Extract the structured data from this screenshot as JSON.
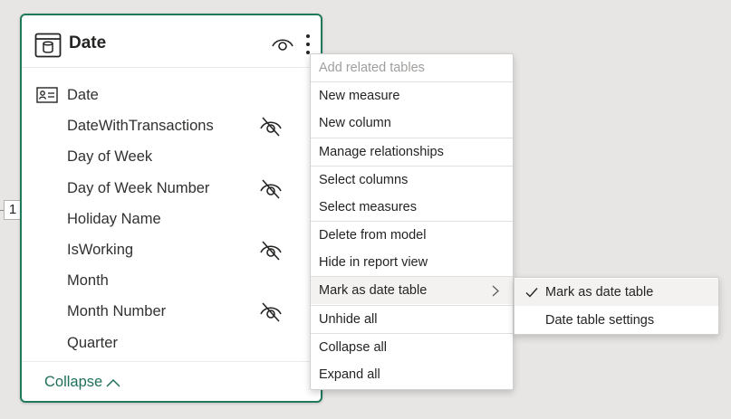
{
  "card": {
    "title": "Date",
    "fields": [
      {
        "label": "Date",
        "hidden": false,
        "key": true
      },
      {
        "label": "DateWithTransactions",
        "hidden": true,
        "key": false
      },
      {
        "label": "Day of Week",
        "hidden": false,
        "key": false
      },
      {
        "label": "Day of Week Number",
        "hidden": true,
        "key": false
      },
      {
        "label": "Holiday Name",
        "hidden": false,
        "key": false
      },
      {
        "label": "IsWorking",
        "hidden": true,
        "key": false
      },
      {
        "label": "Month",
        "hidden": false,
        "key": false
      },
      {
        "label": "Month Number",
        "hidden": true,
        "key": false
      },
      {
        "label": "Quarter",
        "hidden": false,
        "key": false
      }
    ],
    "collapse_label": "Collapse"
  },
  "relationship_marker": "1",
  "context_menu": {
    "items": [
      {
        "label": "Add related tables",
        "disabled": true
      },
      {
        "label": "New measure"
      },
      {
        "label": "New column"
      },
      {
        "label": "Manage relationships"
      },
      {
        "label": "Select columns"
      },
      {
        "label": "Select measures"
      },
      {
        "label": "Delete from model"
      },
      {
        "label": "Hide in report view"
      },
      {
        "label": "Mark as date table",
        "submenu": true,
        "active": true
      },
      {
        "label": "Unhide all"
      },
      {
        "label": "Collapse all"
      },
      {
        "label": "Expand all"
      }
    ]
  },
  "submenu": {
    "items": [
      {
        "label": "Mark as date table",
        "checked": true
      },
      {
        "label": "Date table settings",
        "checked": false
      }
    ]
  },
  "colors": {
    "accent": "#1f7a5c",
    "link": "#1f6f5a",
    "background": "#e8e6e4"
  },
  "icons": {
    "table": "table-icon",
    "visibility": "eye-icon",
    "more": "more-options-icon",
    "hidden": "hidden-eye-icon",
    "key": "id-card-icon",
    "chevron": "chevron-right-icon",
    "check": "checkmark-icon"
  }
}
